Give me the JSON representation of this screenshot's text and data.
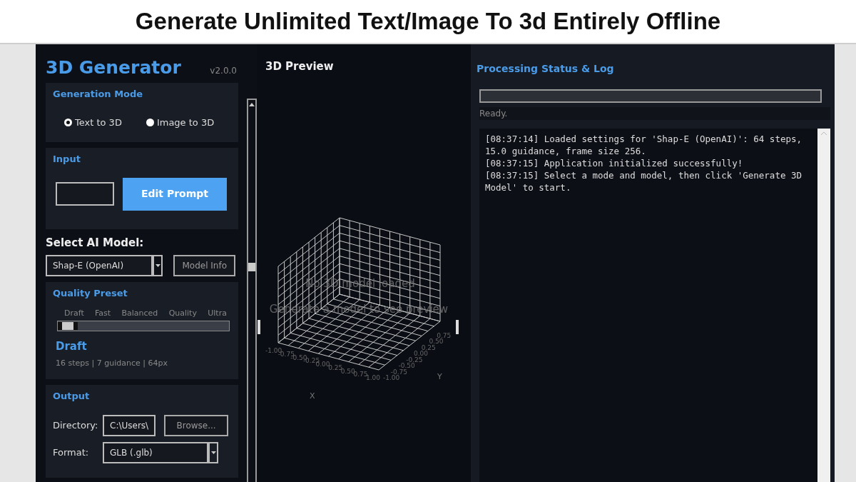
{
  "banner_title": "Generate Unlimited Text/Image To 3d Entirely Offline",
  "app": {
    "title": "3D Generator",
    "version": "v2.0.0"
  },
  "generation_mode": {
    "heading": "Generation Mode",
    "options": [
      {
        "label": "Text to 3D",
        "selected": true
      },
      {
        "label": "Image to 3D",
        "selected": false
      }
    ]
  },
  "input": {
    "heading": "Input",
    "button": "Edit Prompt"
  },
  "model": {
    "heading": "Select AI Model:",
    "value": "Shap-E (OpenAI)",
    "button": "Model Info"
  },
  "quality": {
    "heading": "Quality Preset",
    "stops": [
      "Draft",
      "Fast",
      "Balanced",
      "Quality",
      "Ultra"
    ],
    "level": 0,
    "current": "Draft",
    "details": "16 steps | 7 guidance | 64px"
  },
  "output": {
    "heading": "Output",
    "fields": [
      {
        "kind": "text",
        "label": "Directory:",
        "value": "C:\\Users\\",
        "button": "Browse..."
      },
      {
        "kind": "select",
        "label": "Format:",
        "value": "GLB (.glb)"
      }
    ]
  },
  "preview": {
    "heading": "3D Preview",
    "message": "No 3D model loaded",
    "hint": "Generate a model to see preview",
    "axes": {
      "x_label": "X",
      "y_label": "Y",
      "x_ticks": [
        "-1.00",
        "-0.75",
        "-0.50",
        "-0.25",
        "0.00",
        "0.25",
        "0.50",
        "0.75",
        "1.00"
      ],
      "y_ticks": [
        "-1.00",
        "-0.75",
        "-0.50",
        "-0.25",
        "0.00",
        "0.25",
        "0.50",
        "0.75"
      ]
    }
  },
  "status": {
    "heading": "Processing Status & Log",
    "status_text": "Ready.",
    "log": [
      "[08:37:14] Loaded settings for 'Shap-E (OpenAI)': 64 steps, 15.0 guidance, frame size 256.",
      "[08:37:15] Application initialized successfully!",
      "[08:37:15] Select a mode and model, then click 'Generate 3D Model' to start."
    ]
  }
}
